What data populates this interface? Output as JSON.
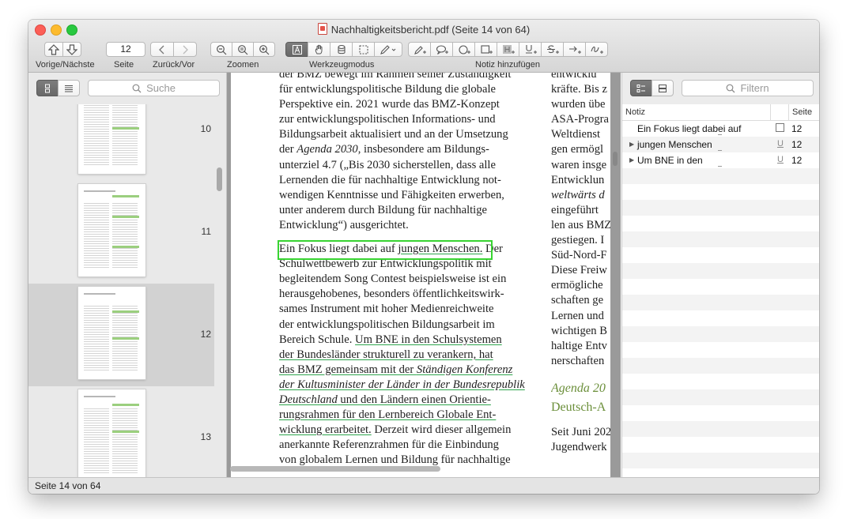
{
  "window": {
    "title": "Nachhaltigkeitsbericht.pdf (Seite 14 von 64)"
  },
  "toolbar": {
    "page_value": "12",
    "labels": {
      "prev_next": "Vorige/Nächste",
      "page": "Seite",
      "back_forward": "Zurück/Vor",
      "zoom": "Zoomen",
      "tool_mode": "Werkzeugmodus",
      "add_note": "Notiz hinzufügen"
    }
  },
  "sidebar": {
    "search_placeholder": "Suche",
    "thumbnails": [
      {
        "page": "10"
      },
      {
        "page": "11"
      },
      {
        "page": "12",
        "selected": true
      },
      {
        "page": "13"
      }
    ]
  },
  "document": {
    "col1_lines": [
      "der BMZ bewegt im Rahmen seiner Zuständigkeit",
      "für entwicklungspolitische Bildung die globale",
      "Perspektive ein. 2021 wurde das BMZ-Konzept",
      "zur entwicklungspolitischen Informations- und",
      "Bildungsarbeit aktualisiert und an der Umsetzung",
      "der Agenda 2030, insbesondere am Bildungs-",
      "unterziel 4.7 („Bis 2030 sicherstellen, dass alle",
      "Lernenden die für nachhaltige Entwicklung not-",
      "wendigen Kenntnisse und Fähigkeiten erwerben,",
      "unter anderem durch Bildung für nachhaltige",
      "Entwicklung“) ausgerichtet.",
      "",
      "Ein Fokus liegt dabei auf jungen Menschen. Der",
      "Schulwettbewerb zur Entwicklungspolitik mit",
      "begleitendem Song Contest beispielsweise ist ein",
      "herausgehobenes, besonders öffentlichkeitswirk-",
      "sames Instrument mit hoher Medienreichweite",
      "der entwicklungspolitischen Bildungsarbeit im",
      "Bereich Schule. Um BNE in den Schulsystemen",
      "der Bundesländer strukturell zu verankern, hat",
      "das BMZ gemeinsam mit der Ständigen Konferenz",
      "der Kultusminister der Länder in der Bundesrepublik",
      "Deutschland und den Ländern einen Orientie-",
      "rungsrahmen für den Lernbereich Globale Ent-",
      "wicklung erarbeitet. Derzeit wird dieser allgemein",
      "anerkannte Referenzrahmen für die Einbindung",
      "von globalem Lernen und Bildung für nachhaltige"
    ],
    "col1_parts": {
      "l6_pre": "der ",
      "l6_ital": "Agenda 2030",
      "l6_post": ", insbesondere am Bildungs-",
      "l13_pre": "Ein Fokus liegt dabei auf ",
      "l13_ul": "jungen Menschen.",
      "l13_post": " Der",
      "l19_pre": "Bereich Schule. ",
      "l19_ul": "Um BNE in den Schulsystemen",
      "l21_pre": "das BMZ gemeinsam mit der ",
      "l21_ital": "Ständigen Konferenz",
      "l23_ital": "Deutschland",
      "l23_post": " und den Ländern einen Orientie-",
      "l25_ul": "wicklung erarbeitet.",
      "l25_post": " Derzeit wird dieser allgemein"
    },
    "col2_lines": [
      "entwicklu",
      "kräfte. Bis z",
      "wurden übe",
      "ASA-Progra",
      "Weltdienst",
      "gen ermögl",
      "waren insge",
      "Entwicklun",
      "weltwärts d",
      "eingeführt",
      "len aus BMZ",
      "gestiegen. I",
      "Süd-Nord-F",
      "Diese Freiw",
      "ermögliche",
      "schaften ge",
      "Lernen und",
      "wichtigen B",
      "haltige Entv",
      "nerschaften"
    ],
    "col2_heading": [
      "Agenda 20",
      "Deutsch-A"
    ],
    "col2_tail": [
      "Seit Juni 202",
      "Jugendwerk"
    ]
  },
  "notes_panel": {
    "filter_placeholder": "Filtern",
    "columns": {
      "note": "Notiz",
      "page": "Seite"
    },
    "rows": [
      {
        "text": "Ein Fokus liegt dabei auf",
        "type": "box-icon",
        "page": "12",
        "expandable": false
      },
      {
        "text": "jungen Menschen",
        "type": "underline-icon",
        "page": "12",
        "expandable": true
      },
      {
        "text": "Um BNE in den",
        "type": "underline-icon",
        "page": "12",
        "expandable": true
      }
    ]
  },
  "status_bar": {
    "text": "Seite 14 von 64"
  },
  "colors": {
    "highlight_box": "#38d431",
    "underline": "#2ea54d",
    "heading_green": "#6b8f3a"
  }
}
